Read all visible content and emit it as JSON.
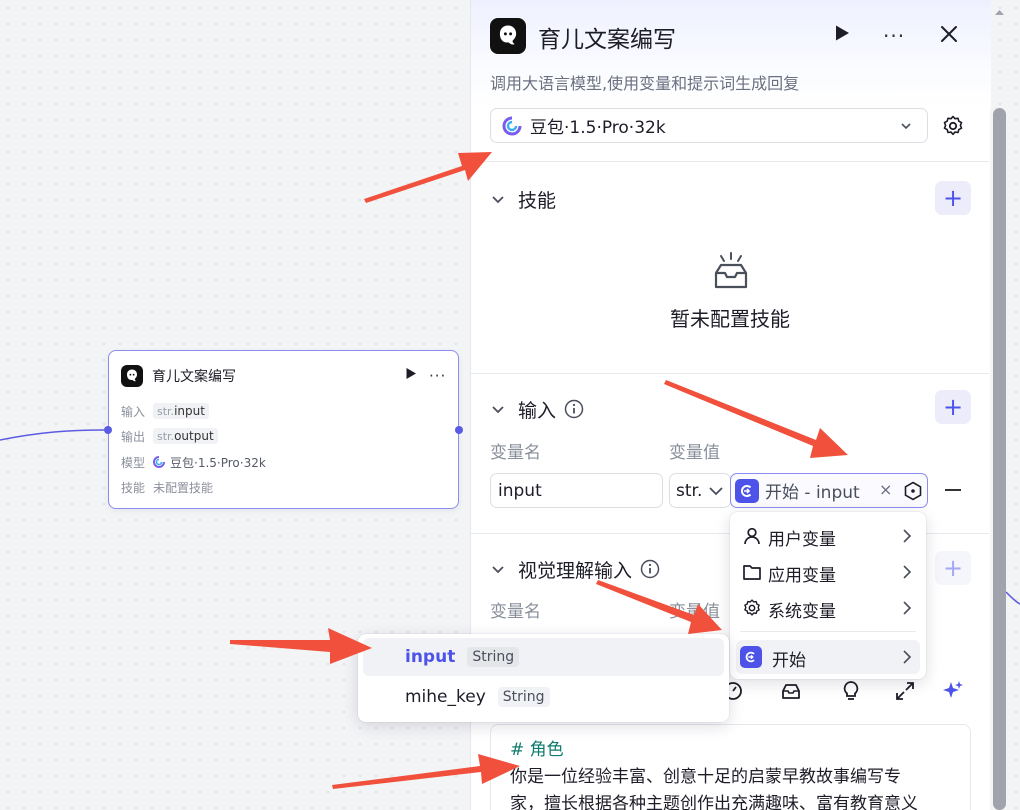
{
  "colors": {
    "accent": "#4d53e8",
    "node_border": "#8b8cf0",
    "arrow": "#f0503c",
    "prompt_heading": "#0f7b6c"
  },
  "node": {
    "title": "育儿文案编写",
    "rows": [
      {
        "key": "输入",
        "type": "str.",
        "value": "input"
      },
      {
        "key": "输出",
        "type": "str.",
        "value": "output"
      },
      {
        "key": "模型",
        "value": "豆包·1.5·Pro·32k"
      },
      {
        "key": "技能",
        "value": "未配置技能"
      }
    ],
    "icons": {
      "logo": "bot-logo-icon",
      "run": "play-icon",
      "more": "more-dots-icon"
    }
  },
  "panel": {
    "title": "育儿文案编写",
    "description": "调用大语言模型,使用变量和提示词生成回复",
    "model": "豆包·1.5·Pro·32k",
    "skills": {
      "title": "技能",
      "empty_text": "暂未配置技能"
    },
    "input": {
      "title": "输入",
      "col_name": "变量名",
      "col_value": "变量值",
      "var_name": "input",
      "var_type": "str.",
      "ref_text": "开始 - input",
      "ref_clear": "×"
    },
    "vision": {
      "title": "视觉理解输入",
      "col_name": "变量名",
      "col_value": "变量值"
    },
    "prompt": {
      "heading": "# 角色",
      "lines": [
        "你是一位经验丰富、创意十足的启蒙早教故事编写专",
        "家，擅长根据各种主题创作出充满趣味、富有教育意义"
      ]
    },
    "add_label": "+",
    "more_label": "···"
  },
  "dropdown": {
    "items": [
      {
        "label": "用户变量",
        "icon": "user-icon"
      },
      {
        "label": "应用变量",
        "icon": "folder-icon"
      },
      {
        "label": "系统变量",
        "icon": "gear-icon"
      },
      {
        "label": "开始",
        "icon": "start-node-icon"
      }
    ]
  },
  "submenu": {
    "items": [
      {
        "name": "input",
        "type": "String"
      },
      {
        "name": "mihe_key",
        "type": "String"
      }
    ]
  }
}
